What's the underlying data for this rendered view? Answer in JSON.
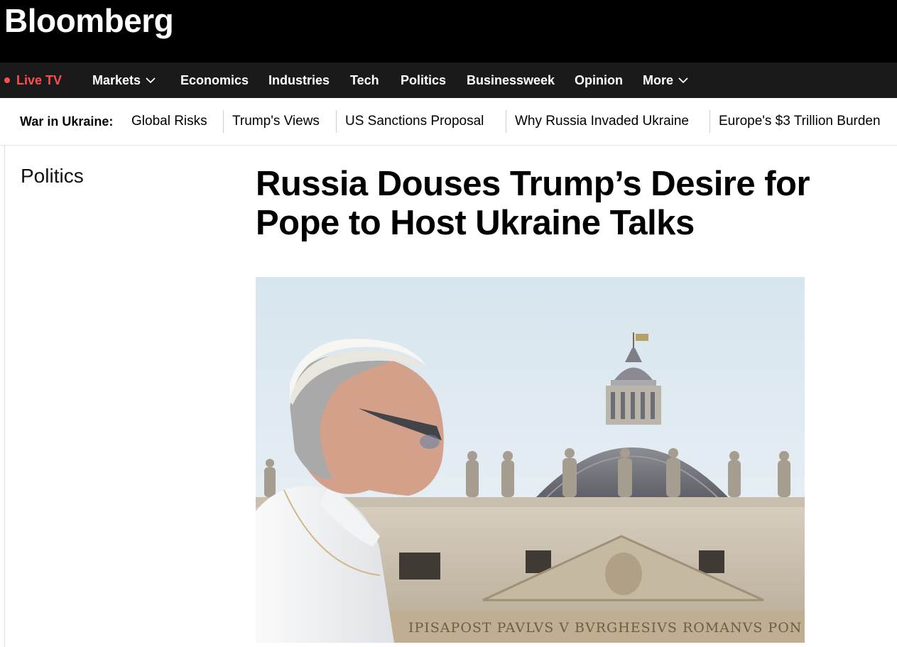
{
  "header": {
    "brand": "Bloomberg"
  },
  "nav": {
    "live": "Live TV",
    "items": [
      "Markets",
      "Economics",
      "Industries",
      "Tech",
      "Politics",
      "Businessweek",
      "Opinion",
      "More"
    ]
  },
  "topic_strip": {
    "label": "War in Ukraine:",
    "links": [
      "Global Risks",
      "Trump's Views",
      "US Sanctions Proposal",
      "Why Russia Invaded Ukraine",
      "Europe's $3 Trillion Burden"
    ]
  },
  "article": {
    "section": "Politics",
    "headline": "Russia Douses Trump’s Desire for Pope to Host Ukraine Talks",
    "inscription": "IPISAPOST PAVLVS V BVRGHESIVS ROMANVS PON"
  },
  "colors": {
    "live_red": "#ff4d4d",
    "nav_bg": "#1a1a1a",
    "brand_bg": "#000000"
  }
}
